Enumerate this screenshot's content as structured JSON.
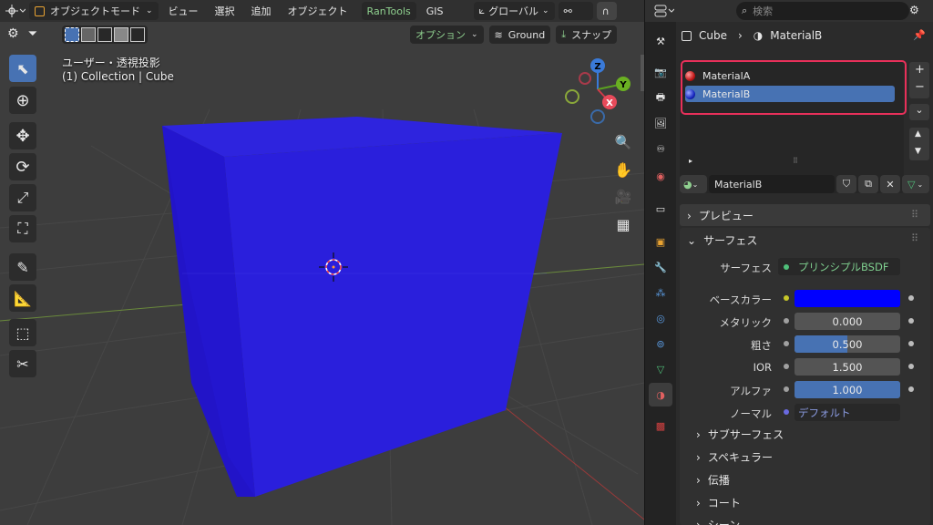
{
  "viewport": {
    "header": {
      "mode": "オブジェクトモード",
      "menus": [
        "ビュー",
        "選択",
        "追加",
        "オブジェクト"
      ],
      "addon_rantools": "RanTools",
      "addon_gis": "GIS",
      "transform": "グローバル"
    },
    "header2": {
      "options": "オプション",
      "ground": "Ground",
      "snap": "スナップ"
    },
    "overlay_line1": "ユーザー・透視投影",
    "overlay_line2": "(1) Collection | Cube",
    "gizmo": {
      "z": "Z",
      "y": "Y",
      "x": "X"
    },
    "cube_color": "#2a1fdc"
  },
  "properties": {
    "search_placeholder": "検索",
    "breadcrumb": {
      "object": "Cube",
      "material": "MaterialB"
    },
    "slots": [
      {
        "name": "MaterialA",
        "color": "#d42a2a",
        "selected": false
      },
      {
        "name": "MaterialB",
        "color": "#2a3ad4",
        "selected": true
      }
    ],
    "material_name": "MaterialB",
    "sections": {
      "preview": "プレビュー",
      "surface": "サーフェス"
    },
    "surface": {
      "surface_label": "サーフェス",
      "surface_value": "プリンシプルBSDF",
      "base_color_label": "ベースカラー",
      "base_color": "#0000ff",
      "metallic_label": "メタリック",
      "metallic": "0.000",
      "roughness_label": "粗さ",
      "roughness": "0.500",
      "roughness_fraction": 0.5,
      "ior_label": "IOR",
      "ior": "1.500",
      "alpha_label": "アルファ",
      "alpha": "1.000",
      "alpha_fraction": 1.0,
      "normal_label": "ノーマル",
      "normal_value": "デフォルト"
    },
    "subsections": [
      "サブサーフェス",
      "スペキュラー",
      "伝播",
      "コート",
      "シーン"
    ],
    "highlight_color": "#e8305a",
    "accent": "#4772b3"
  }
}
